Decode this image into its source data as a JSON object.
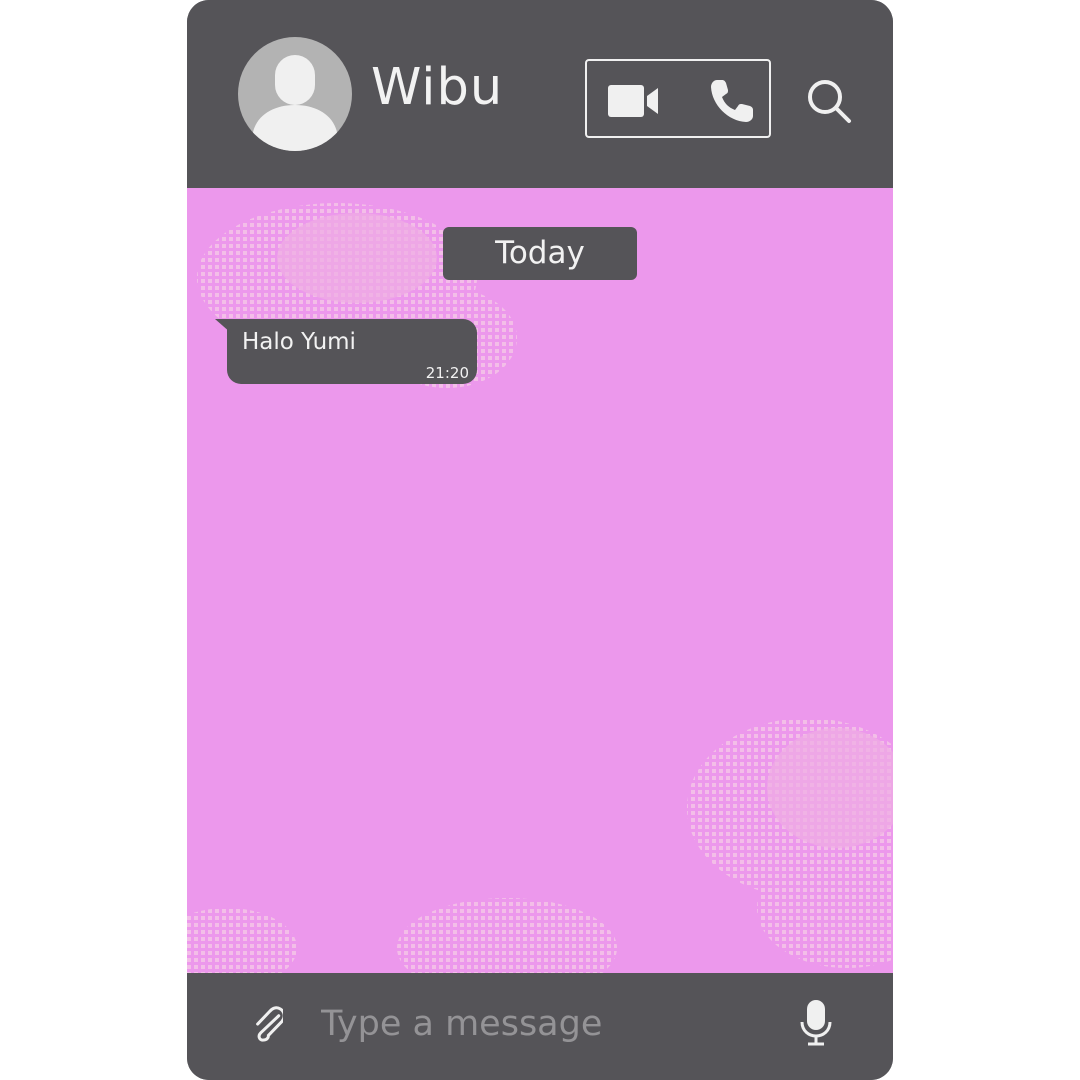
{
  "header": {
    "contact_name": "Wibu",
    "icons": {
      "avatar": "default-user-avatar",
      "video_call": "video-camera-icon",
      "voice_call": "phone-icon",
      "search": "search-icon"
    }
  },
  "chat": {
    "date_label": "Today",
    "messages": [
      {
        "text": "Halo Yumi",
        "time": "21:20",
        "direction": "incoming"
      }
    ]
  },
  "footer": {
    "placeholder": "Type a message",
    "value": "",
    "icons": {
      "attach": "paperclip-icon",
      "voice": "microphone-icon"
    }
  },
  "colors": {
    "chrome": "#555458",
    "chat_background": "#ec98ec",
    "foreground": "#f2f2f2",
    "avatar": "#b3b3b3",
    "placeholder": "#949396"
  }
}
